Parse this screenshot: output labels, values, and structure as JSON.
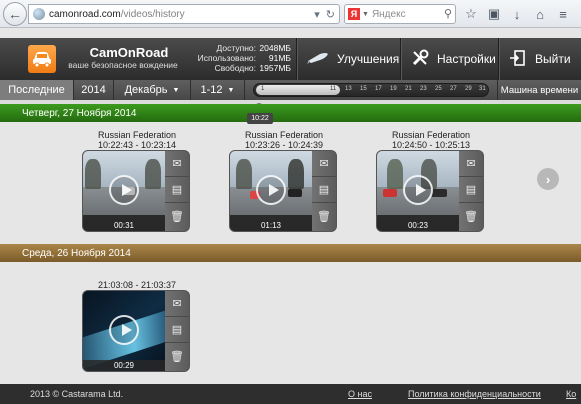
{
  "browser": {
    "url_host": "camonroad.com",
    "url_path": "/videos/history",
    "search_engine": "Яндекс",
    "toolbar_icons": [
      "star-icon",
      "bookmarks-icon",
      "download-icon",
      "home-icon",
      "menu-icon"
    ]
  },
  "header": {
    "brand": "CamOnRoad",
    "tagline": "ваше безопасное вождение",
    "stats": [
      {
        "label": "Доступно:",
        "value": "2048МБ"
      },
      {
        "label": "Использовано:",
        "value": "91МБ"
      },
      {
        "label": "Свободно:",
        "value": "1957МБ"
      }
    ],
    "upgrades": "Улучшения",
    "settings": "Настройки",
    "logout": "Выйти"
  },
  "filters": {
    "recent": "Последние",
    "year": "2014",
    "month": "Декабрь",
    "day_range": "1-12",
    "days_selected_start": "1",
    "days_selected_end": "11",
    "days_other": [
      "13",
      "15",
      "17",
      "19",
      "21",
      "23",
      "25",
      "27",
      "29",
      "31"
    ],
    "time_machine": "Машина времени"
  },
  "timeline": {
    "current_time": "10:22"
  },
  "groups": [
    {
      "date": "Четверг, 27 Ноября 2014",
      "videos": [
        {
          "location": "Russian Federation",
          "time_range": "10:22:43 - 10:23:14",
          "duration": "00:31"
        },
        {
          "location": "Russian Federation",
          "time_range": "10:23:26 - 10:24:39",
          "duration": "01:13"
        },
        {
          "location": "Russian Federation",
          "time_range": "10:24:50 - 10:25:13",
          "duration": "00:23"
        }
      ]
    },
    {
      "date": "Среда, 26 Ноября 2014",
      "videos": [
        {
          "location": "",
          "time_range": "21:03:08 - 21:03:37",
          "duration": "00:29"
        }
      ]
    }
  ],
  "footer": {
    "copyright": "2013 © Castarama Ltd.",
    "about": "О нас",
    "privacy": "Политика конфиденциальности",
    "contacts": "Ко"
  }
}
